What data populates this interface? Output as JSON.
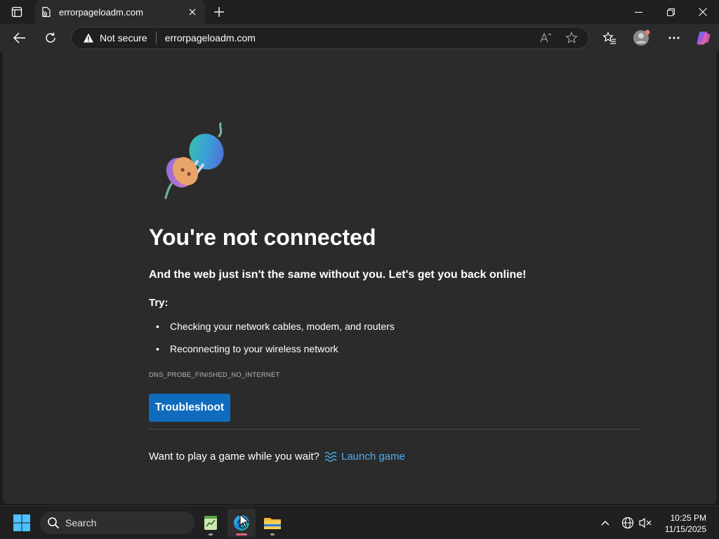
{
  "browser": {
    "tab_title": "errorpageloadm.com",
    "security_label": "Not secure",
    "url": "errorpageloadm.com"
  },
  "page": {
    "headline": "You're not connected",
    "subline": "And the web just isn't the same without you. Let's get you back online!",
    "try_label": "Try:",
    "suggestions": [
      "Checking your network cables, modem, and routers",
      "Reconnecting to your wireless network"
    ],
    "error_code": "DNS_PROBE_FINISHED_NO_INTERNET",
    "troubleshoot_label": "Troubleshoot",
    "game_prompt": "Want to play a game while you wait?",
    "launch_game_label": "Launch game"
  },
  "taskbar": {
    "search_label": "Search",
    "time": "10:25 PM",
    "date": "11/15/2025"
  },
  "colors": {
    "accent": "#0f6cbd",
    "link": "#4cb0f5",
    "page_bg": "#2b2b2b"
  }
}
